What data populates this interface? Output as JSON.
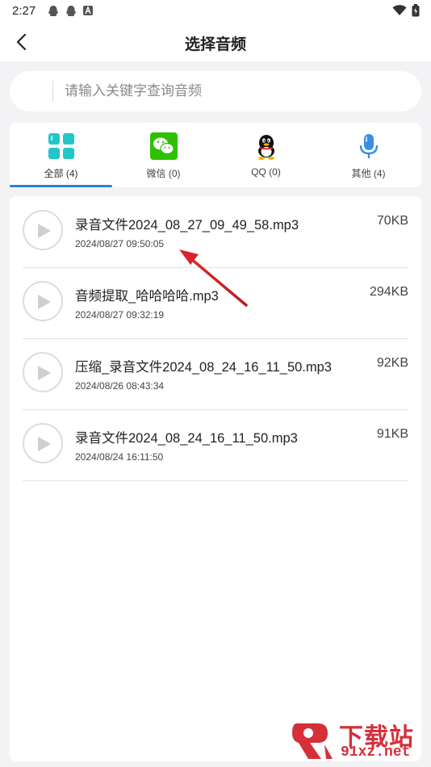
{
  "status_bar": {
    "time": "2:27",
    "left_icons": [
      "qq-notification-icon",
      "qq-notification-icon",
      "app-a-icon"
    ],
    "right_icons": [
      "wifi-icon",
      "battery-icon"
    ]
  },
  "header": {
    "title": "选择音频",
    "back_icon": "chevron-left-icon"
  },
  "search": {
    "placeholder": "请输入关键字查询音频",
    "value": ""
  },
  "tabs": [
    {
      "label": "全部 (4)",
      "icon": "grid-apps-icon",
      "active": true,
      "color": "#23c6c8"
    },
    {
      "label": "微信 (0)",
      "icon": "wechat-icon",
      "active": false,
      "color": "#2dc100"
    },
    {
      "label": "QQ (0)",
      "icon": "qq-penguin-icon",
      "active": false,
      "color": "#000000"
    },
    {
      "label": "其他 (4)",
      "icon": "microphone-icon",
      "active": false,
      "color": "#3a8ee6"
    }
  ],
  "files": [
    {
      "name": "录音文件2024_08_27_09_49_58.mp3",
      "date": "2024/08/27 09:50:05",
      "size": "70KB"
    },
    {
      "name": "音频提取_哈哈哈哈.mp3",
      "date": "2024/08/27 09:32:19",
      "size": "294KB"
    },
    {
      "name": "压缩_录音文件2024_08_24_16_11_50.mp3",
      "date": "2024/08/26 08:43:34",
      "size": "92KB"
    },
    {
      "name": "录音文件2024_08_24_16_11_50.mp3",
      "date": "2024/08/24 16:11:50",
      "size": "91KB"
    }
  ],
  "watermark": {
    "title": "下载站",
    "url": "91xz.net"
  },
  "colors": {
    "accent": "#2f7de1",
    "annotation_arrow": "#d9232d",
    "watermark": "#d52f3a"
  }
}
